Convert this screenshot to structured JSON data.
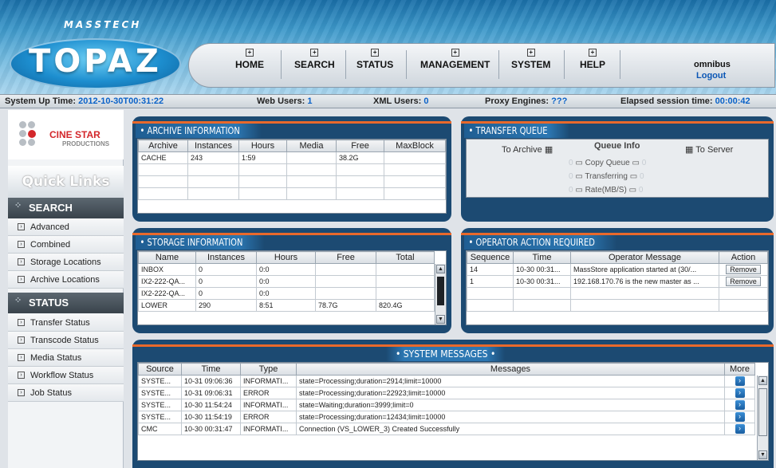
{
  "brand": {
    "company": "MASSTECH",
    "product": "TOPAZ"
  },
  "nav": {
    "items": [
      {
        "label": "HOME"
      },
      {
        "label": "SEARCH"
      },
      {
        "label": "STATUS"
      },
      {
        "label": "MANAGEMENT"
      },
      {
        "label": "SYSTEM"
      },
      {
        "label": "HELP"
      }
    ],
    "user": "omnibus",
    "logout": "Logout"
  },
  "statusbar": {
    "uptime_label": "System Up Time:",
    "uptime_value": "2012-10-30T00:31:22",
    "web_label": "Web Users:",
    "web_value": "1",
    "xml_label": "XML Users:",
    "xml_value": "0",
    "proxy_label": "Proxy Engines:",
    "proxy_value": "???",
    "elapsed_label": "Elapsed session time:",
    "elapsed_value": "00:00:42"
  },
  "sidebar": {
    "logo_title": "CINE STAR",
    "logo_sub": "PRODUCTIONS",
    "quicklinks": "Quick Links",
    "search_head": "SEARCH",
    "search_links": [
      "Advanced",
      "Combined",
      "Storage Locations",
      "Archive Locations"
    ],
    "status_head": "STATUS",
    "status_links": [
      "Transfer Status",
      "Transcode Status",
      "Media Status",
      "Workflow Status",
      "Job Status"
    ]
  },
  "archive": {
    "title": "ARCHIVE INFORMATION",
    "headers": [
      "Archive",
      "Instances",
      "Hours",
      "Media",
      "Free",
      "MaxBlock"
    ],
    "rows": [
      [
        "CACHE",
        "243",
        "1:59",
        "",
        "38.2G",
        ""
      ]
    ]
  },
  "transfer": {
    "title": "TRANSFER QUEUE",
    "to_archive": "To Archive",
    "queue_info": "Queue Info",
    "to_server": "To Server",
    "copy_queue": "Copy Queue",
    "transferring": "Transferring",
    "rate": "Rate(MB/S)",
    "copy_left": "0",
    "copy_right": "0",
    "transferring_left": "0",
    "transferring_right": "0",
    "rate_left": "0",
    "rate_right": "0"
  },
  "storage": {
    "title": "STORAGE INFORMATION",
    "headers": [
      "Name",
      "Instances",
      "Hours",
      "Free",
      "Total"
    ],
    "rows": [
      [
        "INBOX",
        "0",
        "0:0",
        "",
        ""
      ],
      [
        "IX2-222-QA...",
        "0",
        "0:0",
        "",
        ""
      ],
      [
        "IX2-222-QA...",
        "0",
        "0:0",
        "",
        ""
      ],
      [
        "LOWER",
        "290",
        "8:51",
        "78.7G",
        "820.4G"
      ]
    ]
  },
  "operator": {
    "title": "OPERATOR ACTION REQUIRED",
    "headers": [
      "Sequence",
      "Time",
      "Operator Message",
      "Action"
    ],
    "rows": [
      [
        "14",
        "10-30 00:31...",
        "MassStore application started at (30/...",
        "Remove"
      ],
      [
        "1",
        "10-30 00:31...",
        "192.168.170.76 is the new master as ...",
        "Remove"
      ]
    ]
  },
  "messages": {
    "title": "SYSTEM MESSAGES",
    "headers": [
      "Source",
      "Time",
      "Type",
      "Messages",
      "More"
    ],
    "rows": [
      [
        "SYSTE...",
        "10-31 09:06:36",
        "INFORMATI...",
        "state=Processing;duration=2914;limit=10000"
      ],
      [
        "SYSTE...",
        "10-31 09:06:31",
        "ERROR",
        "state=Processing;duration=22923;limit=10000"
      ],
      [
        "SYSTE...",
        "10-30 11:54:24",
        "INFORMATI...",
        "state=Waiting;duration=3999;limit=0"
      ],
      [
        "SYSTE...",
        "10-30 11:54:19",
        "ERROR",
        "state=Processing;duration=12434;limit=10000"
      ],
      [
        "CMC",
        "10-30 00:31:47",
        "INFORMATI...",
        "Connection (VS_LOWER_3) Created Successfully"
      ]
    ]
  }
}
